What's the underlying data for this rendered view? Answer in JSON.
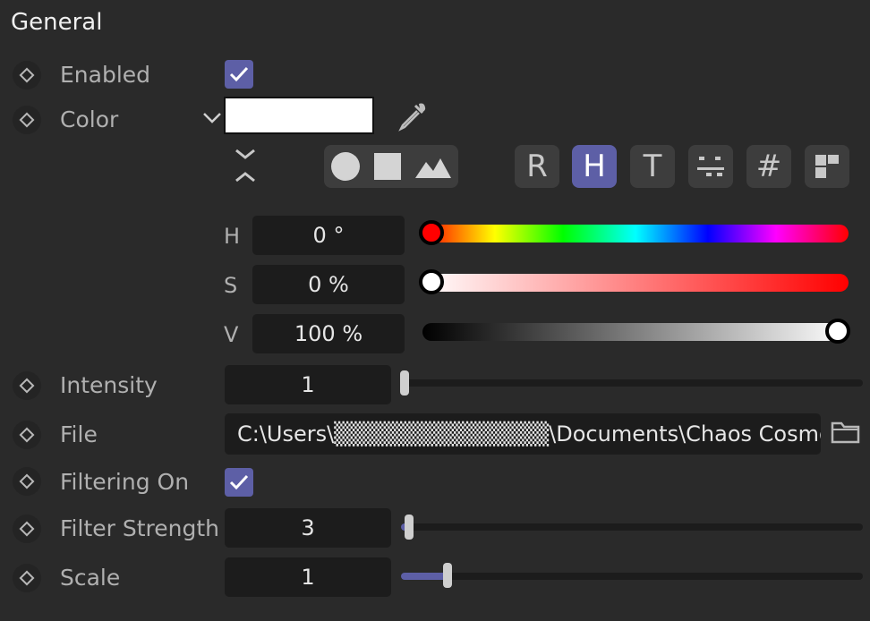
{
  "section": {
    "title": "General"
  },
  "enabled": {
    "label": "Enabled",
    "checked": true
  },
  "color": {
    "label": "Color",
    "swatch_hex": "#ffffff",
    "shape_modes": [
      "circle-icon",
      "square-icon",
      "mountain-icon"
    ],
    "model_buttons": [
      {
        "name": "rgb-mode",
        "label": "R",
        "active": false
      },
      {
        "name": "hsv-mode",
        "label": "H",
        "active": true
      },
      {
        "name": "kelvin-mode",
        "label": "T",
        "active": false
      },
      {
        "name": "mixing-mode",
        "label": "",
        "active": false
      },
      {
        "name": "hex-mode",
        "label": "#",
        "active": false
      },
      {
        "name": "swatches-mode",
        "label": "",
        "active": false
      }
    ],
    "hsv": {
      "h": {
        "letter": "H",
        "value": "0 °",
        "fraction": 0.0
      },
      "s": {
        "letter": "S",
        "value": "0 %",
        "fraction": 0.0
      },
      "v": {
        "letter": "V",
        "value": "100 %",
        "fraction": 1.0
      }
    }
  },
  "intensity": {
    "label": "Intensity",
    "value": "1",
    "fraction": 0.0
  },
  "file": {
    "label": "File",
    "path": "C:\\Users\\▒▒▒▒▒▒▒▒▒▒▒▒▒\\Documents\\Chaos Cosmo"
  },
  "filtering_on": {
    "label": "Filtering On",
    "checked": true
  },
  "filter_strength": {
    "label": "Filter Strength",
    "value": "3",
    "fraction": 0.01
  },
  "scale": {
    "label": "Scale",
    "value": "1",
    "fraction": 0.1
  },
  "colors": {
    "accent": "#5d5fa6",
    "background": "#2a2a2a",
    "field": "#1c1c1c"
  }
}
